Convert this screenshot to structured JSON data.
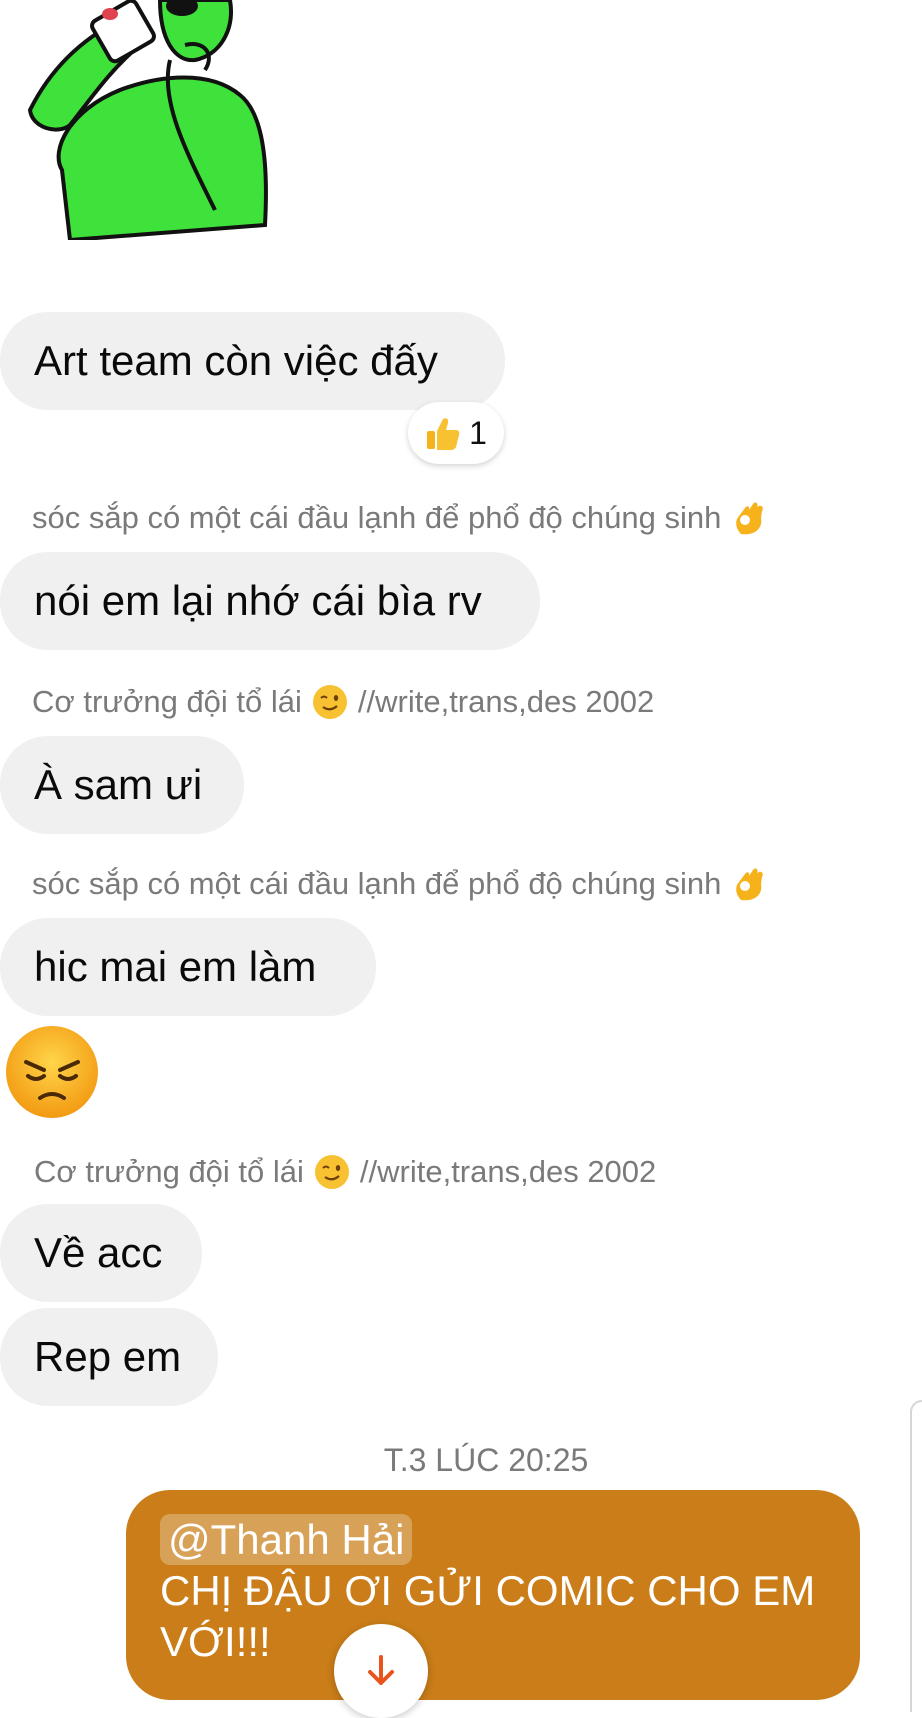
{
  "messages": [
    {
      "text": "Art team còn việc đấy"
    },
    {
      "sender": "sóc sắp có một cái đầu lạnh để phổ độ chúng sinh",
      "text": "nói em lại nhớ cái bìa rv"
    },
    {
      "sender": "Cơ trưởng đội tổ lái",
      "sender_suffix": "//write,trans,des 2002",
      "text": "À sam ưi"
    },
    {
      "sender": "sóc sắp có một cái đầu lạnh để phổ độ chúng sinh",
      "text": "hic mai em làm"
    },
    {
      "sender": "Cơ trưởng đội tổ lái",
      "sender_suffix": "//write,trans,des 2002",
      "texts": [
        "Về acc",
        "Rep em"
      ]
    }
  ],
  "reaction": {
    "icon": "thumbs-up-icon",
    "count": "1"
  },
  "timestamp": "T.3 LÚC 20:25",
  "outgoing": {
    "mention": "@Thanh Hải",
    "text": "CHỊ ĐẬU ƠI GỬI COMIC CHO EM VỚI!!!",
    "color": "#ca7d18"
  },
  "colors": {
    "incoming_bubble": "#f0f0f0",
    "scroll_arrow": "#e8541c"
  }
}
